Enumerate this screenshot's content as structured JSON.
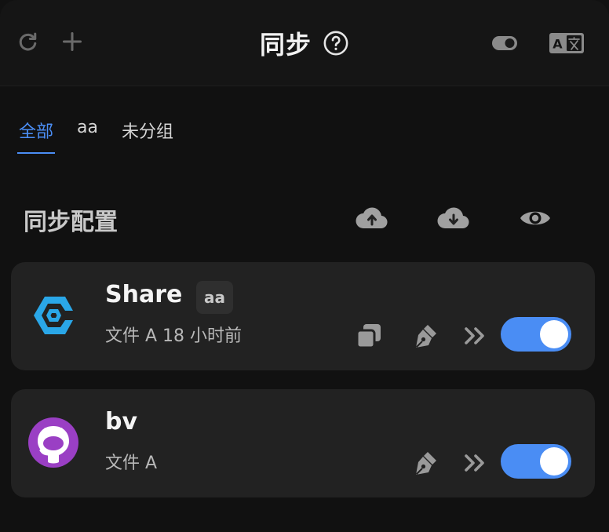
{
  "header": {
    "title": "同步",
    "icons": [
      "refresh-icon",
      "plus-icon",
      "help-circle-icon",
      "toggle-theme-icon",
      "translate-icon"
    ]
  },
  "tabs": [
    {
      "label": "全部",
      "active": true
    },
    {
      "label": "aa",
      "active": false
    },
    {
      "label": "未分组",
      "active": false
    }
  ],
  "section": {
    "title": "同步配置",
    "icons": [
      "cloud-upload-icon",
      "cloud-download-icon",
      "eye-icon"
    ]
  },
  "configs": [
    {
      "name": "Share",
      "badge": "aa",
      "subtitle": "文件 A 18 小时前",
      "enabled": true,
      "logo": "share-logo-icon"
    },
    {
      "name": "bv",
      "badge": "",
      "subtitle": "文件 A",
      "enabled": true,
      "logo": "github-logo-icon"
    }
  ],
  "colors": {
    "accent": "#4a8df4",
    "background": "#111111",
    "card": "#222222"
  }
}
